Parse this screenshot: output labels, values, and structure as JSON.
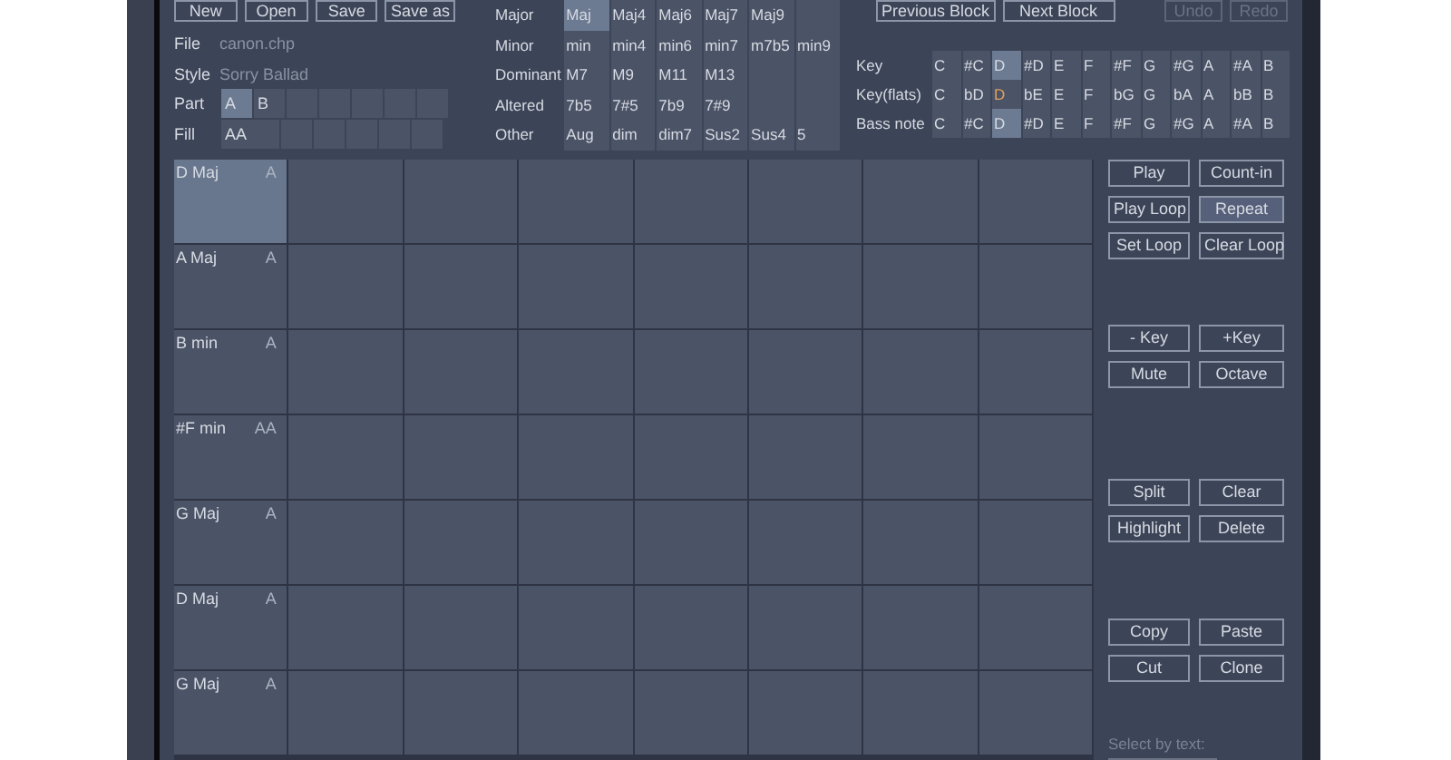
{
  "file_buttons": [
    "New",
    "Open",
    "Save",
    "Save as"
  ],
  "file": {
    "label": "File",
    "value": "canon.chp"
  },
  "style": {
    "label": "Style",
    "value": "Sorry Ballad"
  },
  "part": {
    "label": "Part",
    "options": [
      {
        "label": "A",
        "selected": true
      },
      {
        "label": "B",
        "selected": false
      }
    ]
  },
  "fill": {
    "label": "Fill",
    "options": [
      {
        "label": "AA",
        "selected": false
      }
    ]
  },
  "chord_types": [
    {
      "label": "Major",
      "options": [
        {
          "label": "Maj",
          "selected": true
        },
        {
          "label": "Maj4",
          "selected": false
        },
        {
          "label": "Maj6",
          "selected": false
        },
        {
          "label": "Maj7",
          "selected": false
        },
        {
          "label": "Maj9",
          "selected": false
        }
      ]
    },
    {
      "label": "Minor",
      "options": [
        {
          "label": "min",
          "selected": false
        },
        {
          "label": "min4",
          "selected": false
        },
        {
          "label": "min6",
          "selected": false
        },
        {
          "label": "min7",
          "selected": false
        },
        {
          "label": "m7b5",
          "selected": false
        },
        {
          "label": "min9",
          "selected": false
        }
      ]
    },
    {
      "label": "Dominant",
      "options": [
        {
          "label": "M7",
          "selected": false
        },
        {
          "label": "M9",
          "selected": false
        },
        {
          "label": "M11",
          "selected": false
        },
        {
          "label": "M13",
          "selected": false
        }
      ]
    },
    {
      "label": "Altered",
      "options": [
        {
          "label": "7b5",
          "selected": false
        },
        {
          "label": "7#5",
          "selected": false
        },
        {
          "label": "7b9",
          "selected": false
        },
        {
          "label": "7#9",
          "selected": false
        }
      ]
    },
    {
      "label": "Other",
      "options": [
        {
          "label": "Aug",
          "selected": false
        },
        {
          "label": "dim",
          "selected": false
        },
        {
          "label": "dim7",
          "selected": false
        },
        {
          "label": "Sus2",
          "selected": false
        },
        {
          "label": "Sus4",
          "selected": false
        },
        {
          "label": "5",
          "selected": false
        }
      ]
    }
  ],
  "block_buttons": [
    "Previous Block",
    "Next Block"
  ],
  "history_buttons": [
    {
      "label": "Undo",
      "disabled": true
    },
    {
      "label": "Redo",
      "disabled": true
    }
  ],
  "key_rows": [
    {
      "label": "Key",
      "kind": "box",
      "notes": [
        {
          "label": "C",
          "selected": false
        },
        {
          "label": "#C",
          "selected": false
        },
        {
          "label": "D",
          "selected": true
        },
        {
          "label": "#D",
          "selected": false
        },
        {
          "label": "E",
          "selected": false
        },
        {
          "label": "F",
          "selected": false
        },
        {
          "label": "#F",
          "selected": false
        },
        {
          "label": "G",
          "selected": false
        },
        {
          "label": "#G",
          "selected": false
        },
        {
          "label": "A",
          "selected": false
        },
        {
          "label": "#A",
          "selected": false
        },
        {
          "label": "B",
          "selected": false
        }
      ]
    },
    {
      "label": "Key(flats)",
      "kind": "text",
      "notes": [
        {
          "label": "C",
          "selected": false
        },
        {
          "label": "bD",
          "selected": false
        },
        {
          "label": "D",
          "selected": true
        },
        {
          "label": "bE",
          "selected": false
        },
        {
          "label": "E",
          "selected": false
        },
        {
          "label": "F",
          "selected": false
        },
        {
          "label": "bG",
          "selected": false
        },
        {
          "label": "G",
          "selected": false
        },
        {
          "label": "bA",
          "selected": false
        },
        {
          "label": "A",
          "selected": false
        },
        {
          "label": "bB",
          "selected": false
        },
        {
          "label": "B",
          "selected": false
        }
      ]
    },
    {
      "label": "Bass note",
      "kind": "box",
      "notes": [
        {
          "label": "C",
          "selected": false
        },
        {
          "label": "#C",
          "selected": false
        },
        {
          "label": "D",
          "selected": true
        },
        {
          "label": "#D",
          "selected": false
        },
        {
          "label": "E",
          "selected": false
        },
        {
          "label": "F",
          "selected": false
        },
        {
          "label": "#F",
          "selected": false
        },
        {
          "label": "G",
          "selected": false
        },
        {
          "label": "#G",
          "selected": false
        },
        {
          "label": "A",
          "selected": false
        },
        {
          "label": "#A",
          "selected": false
        },
        {
          "label": "B",
          "selected": false
        }
      ]
    }
  ],
  "chord_grid": [
    {
      "chord": "D Maj",
      "part": "A",
      "selected": true
    },
    {
      "chord": "A Maj",
      "part": "A",
      "selected": false
    },
    {
      "chord": "B min",
      "part": "A",
      "selected": false
    },
    {
      "chord": "#F min",
      "part": "AA",
      "selected": false
    },
    {
      "chord": "G Maj",
      "part": "A",
      "selected": false
    },
    {
      "chord": "D Maj",
      "part": "A",
      "selected": false
    },
    {
      "chord": "G Maj",
      "part": "A",
      "selected": false
    }
  ],
  "action_groups": [
    [
      {
        "label": "Play",
        "on": false
      },
      {
        "label": "Count-in",
        "on": false
      },
      {
        "label": "Play Loop",
        "on": false
      },
      {
        "label": "Repeat",
        "on": true
      },
      {
        "label": "Set Loop",
        "on": false
      },
      {
        "label": "Clear Loop",
        "on": false
      }
    ],
    [
      {
        "label": "- Key",
        "on": false
      },
      {
        "label": "+Key",
        "on": false
      },
      {
        "label": "Mute",
        "on": false
      },
      {
        "label": "Octave",
        "on": false
      }
    ],
    [
      {
        "label": "Split",
        "on": false
      },
      {
        "label": "Clear",
        "on": false
      },
      {
        "label": "Highlight",
        "on": false
      },
      {
        "label": "Delete",
        "on": false
      }
    ],
    [
      {
        "label": "Copy",
        "on": false
      },
      {
        "label": "Paste",
        "on": false
      },
      {
        "label": "Cut",
        "on": false
      },
      {
        "label": "Clone",
        "on": false
      }
    ]
  ],
  "select_by_text": {
    "label": "Select by text:"
  }
}
